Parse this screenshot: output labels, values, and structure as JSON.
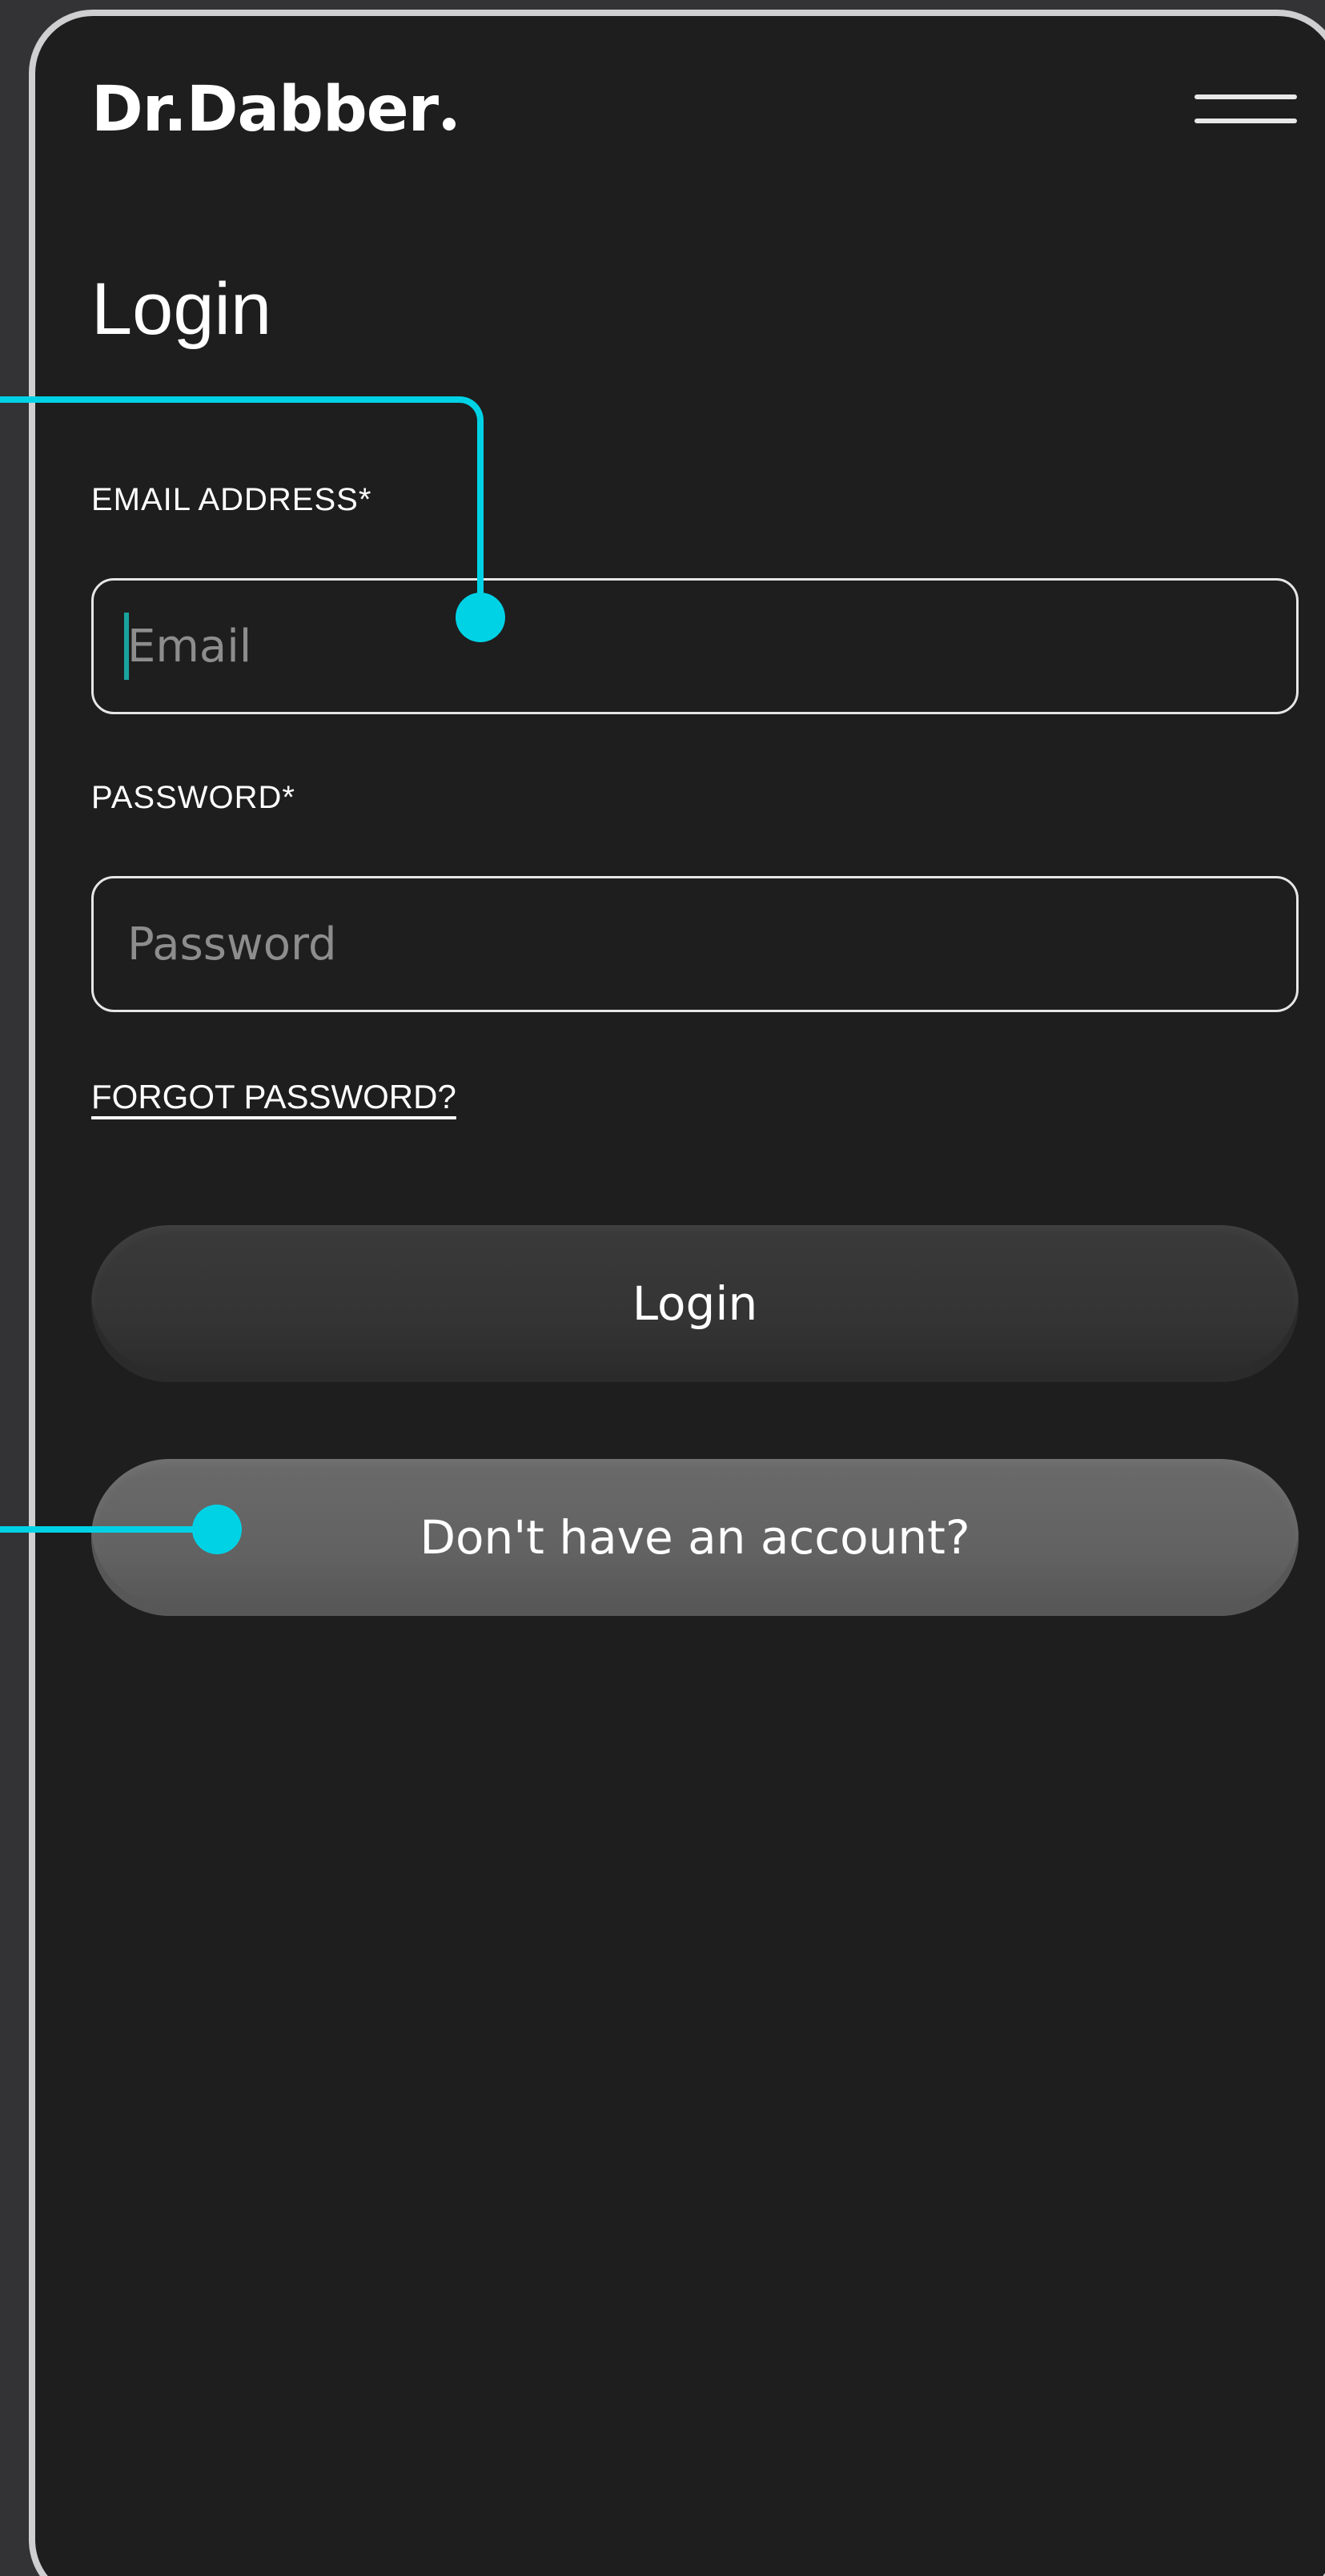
{
  "header": {
    "brand": "Dr.Dabber",
    "menu_icon": "hamburger-menu-icon"
  },
  "login_form": {
    "title": "Login",
    "email": {
      "label": "EMAIL ADDRESS*",
      "placeholder": "Email",
      "value": ""
    },
    "password": {
      "label": "PASSWORD*",
      "placeholder": "Password",
      "value": ""
    },
    "forgot_password": "FORGOT PASSWORD?",
    "login_button": "Login",
    "signup_button": "Don't have an account?"
  },
  "colors": {
    "background": "#1e1e1e",
    "outer_background": "#333336",
    "frame": "#cfcfd2",
    "accent": "#00d2e6",
    "caret": "#1aa3a0",
    "login_button": "#363636",
    "signup_button": "#636363"
  }
}
